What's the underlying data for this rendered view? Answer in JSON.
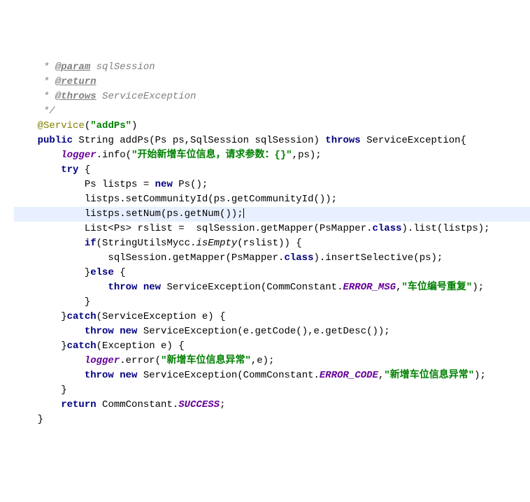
{
  "code": {
    "lines": [
      {
        "indent": "     ",
        "tokens": [
          {
            "cls": "comment",
            "t": "* "
          },
          {
            "cls": "comment-tag",
            "t": "@param"
          },
          {
            "cls": "comment",
            "t": " sqlSession"
          }
        ]
      },
      {
        "indent": "     ",
        "tokens": [
          {
            "cls": "comment",
            "t": "* "
          },
          {
            "cls": "comment-tag",
            "t": "@return"
          }
        ]
      },
      {
        "indent": "     ",
        "tokens": [
          {
            "cls": "comment",
            "t": "* "
          },
          {
            "cls": "comment-tag",
            "t": "@throws"
          },
          {
            "cls": "comment",
            "t": " ServiceException"
          }
        ]
      },
      {
        "indent": "     ",
        "tokens": [
          {
            "cls": "comment",
            "t": "*/"
          }
        ]
      },
      {
        "indent": "    ",
        "tokens": [
          {
            "cls": "annotation",
            "t": "@Service"
          },
          {
            "t": "("
          },
          {
            "cls": "string",
            "t": "\"addPs\""
          },
          {
            "t": ")"
          }
        ]
      },
      {
        "indent": "    ",
        "tokens": [
          {
            "cls": "keyword",
            "t": "public"
          },
          {
            "t": " String addPs(Ps ps,SqlSession sqlSession) "
          },
          {
            "cls": "keyword",
            "t": "throws"
          },
          {
            "t": " ServiceException{"
          }
        ]
      },
      {
        "indent": "        ",
        "tokens": [
          {
            "cls": "field",
            "t": "logger"
          },
          {
            "t": ".info("
          },
          {
            "cls": "string",
            "t": "\"开始新增车位信息，请求参数：{}\""
          },
          {
            "t": ",ps);"
          }
        ]
      },
      {
        "indent": "        ",
        "tokens": [
          {
            "cls": "keyword",
            "t": "try"
          },
          {
            "t": " {"
          }
        ]
      },
      {
        "indent": "            ",
        "tokens": [
          {
            "t": "Ps listps = "
          },
          {
            "cls": "keyword",
            "t": "new"
          },
          {
            "t": " Ps();"
          }
        ]
      },
      {
        "indent": "            ",
        "tokens": [
          {
            "t": "listps.setCommunityId(ps.getCommunityId());"
          }
        ]
      },
      {
        "indent": "            ",
        "highlighted": true,
        "tokens": [
          {
            "t": "listps.setNum(ps.getNum());"
          },
          {
            "cursor": true
          }
        ]
      },
      {
        "indent": "            ",
        "tokens": [
          {
            "t": "List<Ps> rslist =  sqlSession.getMapper(PsMapper."
          },
          {
            "cls": "keyword",
            "t": "class"
          },
          {
            "t": ").list(listps);"
          }
        ]
      },
      {
        "indent": "            ",
        "tokens": [
          {
            "cls": "keyword",
            "t": "if"
          },
          {
            "t": "(StringUtilsMycc."
          },
          {
            "cls": "static-method",
            "t": "isEmpty"
          },
          {
            "t": "(rslist)) {"
          }
        ]
      },
      {
        "indent": "                ",
        "tokens": [
          {
            "t": "sqlSession.getMapper(PsMapper."
          },
          {
            "cls": "keyword",
            "t": "class"
          },
          {
            "t": ").insertSelective(ps);"
          }
        ]
      },
      {
        "indent": "            ",
        "tokens": [
          {
            "t": "}"
          },
          {
            "cls": "keyword",
            "t": "else"
          },
          {
            "t": " {"
          }
        ]
      },
      {
        "indent": "                ",
        "tokens": [
          {
            "cls": "keyword",
            "t": "throw new"
          },
          {
            "t": " ServiceException(CommConstant."
          },
          {
            "cls": "static-const",
            "t": "ERROR_MSG"
          },
          {
            "t": ","
          },
          {
            "cls": "string",
            "t": "\"车位编号重复\""
          },
          {
            "t": ");"
          }
        ]
      },
      {
        "indent": "            ",
        "tokens": [
          {
            "t": "}"
          }
        ]
      },
      {
        "indent": "        ",
        "tokens": [
          {
            "t": "}"
          },
          {
            "cls": "keyword",
            "t": "catch"
          },
          {
            "t": "(ServiceException e) {"
          }
        ]
      },
      {
        "indent": "            ",
        "tokens": [
          {
            "cls": "keyword",
            "t": "throw new"
          },
          {
            "t": " ServiceException(e.getCode(),e.getDesc());"
          }
        ]
      },
      {
        "indent": "        ",
        "tokens": [
          {
            "t": "}"
          },
          {
            "cls": "keyword",
            "t": "catch"
          },
          {
            "t": "(Exception e) {"
          }
        ]
      },
      {
        "indent": "            ",
        "tokens": [
          {
            "cls": "field",
            "t": "logger"
          },
          {
            "t": ".error("
          },
          {
            "cls": "string",
            "t": "\"新增车位信息异常\""
          },
          {
            "t": ",e);"
          }
        ]
      },
      {
        "indent": "            ",
        "tokens": [
          {
            "cls": "keyword",
            "t": "throw new"
          },
          {
            "t": " ServiceException(CommConstant."
          },
          {
            "cls": "static-const",
            "t": "ERROR_CODE"
          },
          {
            "t": ","
          },
          {
            "cls": "string",
            "t": "\"新增车位信息异常\""
          },
          {
            "t": ");"
          }
        ]
      },
      {
        "indent": "        ",
        "tokens": [
          {
            "t": "}"
          }
        ]
      },
      {
        "indent": "        ",
        "tokens": [
          {
            "cls": "keyword",
            "t": "return"
          },
          {
            "t": " CommConstant."
          },
          {
            "cls": "static-const",
            "t": "SUCCESS"
          },
          {
            "t": ";"
          }
        ]
      },
      {
        "indent": "    ",
        "tokens": [
          {
            "t": "}"
          }
        ]
      }
    ]
  }
}
